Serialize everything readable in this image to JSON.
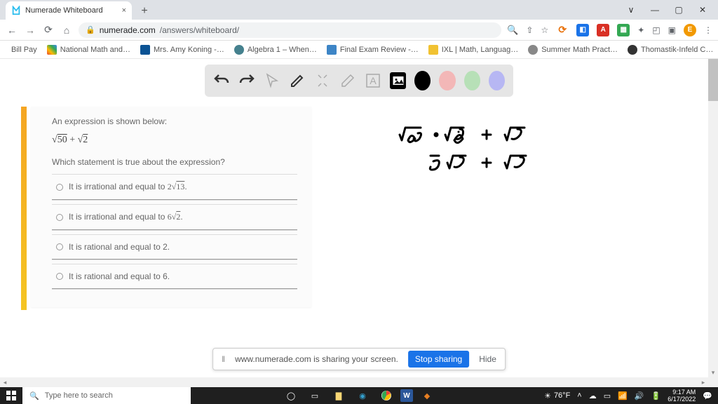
{
  "window": {
    "tab_title": "Numerade Whiteboard",
    "min": "—",
    "max": "▢",
    "close": "✕",
    "expand": "∨"
  },
  "address": {
    "host": "numerade.com",
    "path": "/answers/whiteboard/"
  },
  "bookmarks": {
    "items": [
      {
        "label": "Bill Pay",
        "color": ""
      },
      {
        "label": "National Math and…",
        "color": "#4285f4"
      },
      {
        "label": "Mrs. Amy Koning -…",
        "color": "#0b5394"
      },
      {
        "label": "Algebra 1 – When…",
        "color": "#45818e"
      },
      {
        "label": "Final Exam Review -…",
        "color": "#3d85c6"
      },
      {
        "label": "IXL | Math, Languag…",
        "color": "#f1c232"
      },
      {
        "label": "Summer Math Pract…",
        "color": "#888"
      },
      {
        "label": "Thomastik-Infeld C…",
        "color": "#555"
      }
    ],
    "overflow": "»"
  },
  "toolbar": {
    "undo": "undo",
    "redo": "redo",
    "pointer": "pointer",
    "pen": "pen",
    "tools": "tools",
    "eraser": "eraser",
    "text": "text",
    "image": "image",
    "colors": {
      "black": "#000000",
      "pink": "#f3b7b7",
      "green": "#b7e0b7",
      "purple": "#b7b7f3"
    }
  },
  "question": {
    "prompt": "An expression is shown below:",
    "expr_a": "50",
    "expr_plus": " + ",
    "expr_b": "2",
    "which": "Which statement is true about the expression?",
    "options": [
      {
        "text_a": "It is irrational and equal to ",
        "coef": "2",
        "rad": "13",
        "suffix": "."
      },
      {
        "text_a": "It is irrational and equal to ",
        "coef": "6",
        "rad": "2",
        "suffix": "."
      },
      {
        "text_a": "It is rational and equal to 2.",
        "coef": "",
        "rad": "",
        "suffix": ""
      },
      {
        "text_a": "It is rational and equal to 6.",
        "coef": "",
        "rad": "",
        "suffix": ""
      }
    ]
  },
  "handwriting": {
    "line1": "√25 · √2  +  √2",
    "line2": "5√2  +  √2"
  },
  "share": {
    "msg": "www.numerade.com is sharing your screen.",
    "stop": "Stop sharing",
    "hide": "Hide"
  },
  "taskbar": {
    "search_placeholder": "Type here to search",
    "temp": "76°F",
    "time": "9:17 AM",
    "date": "6/17/2022"
  }
}
